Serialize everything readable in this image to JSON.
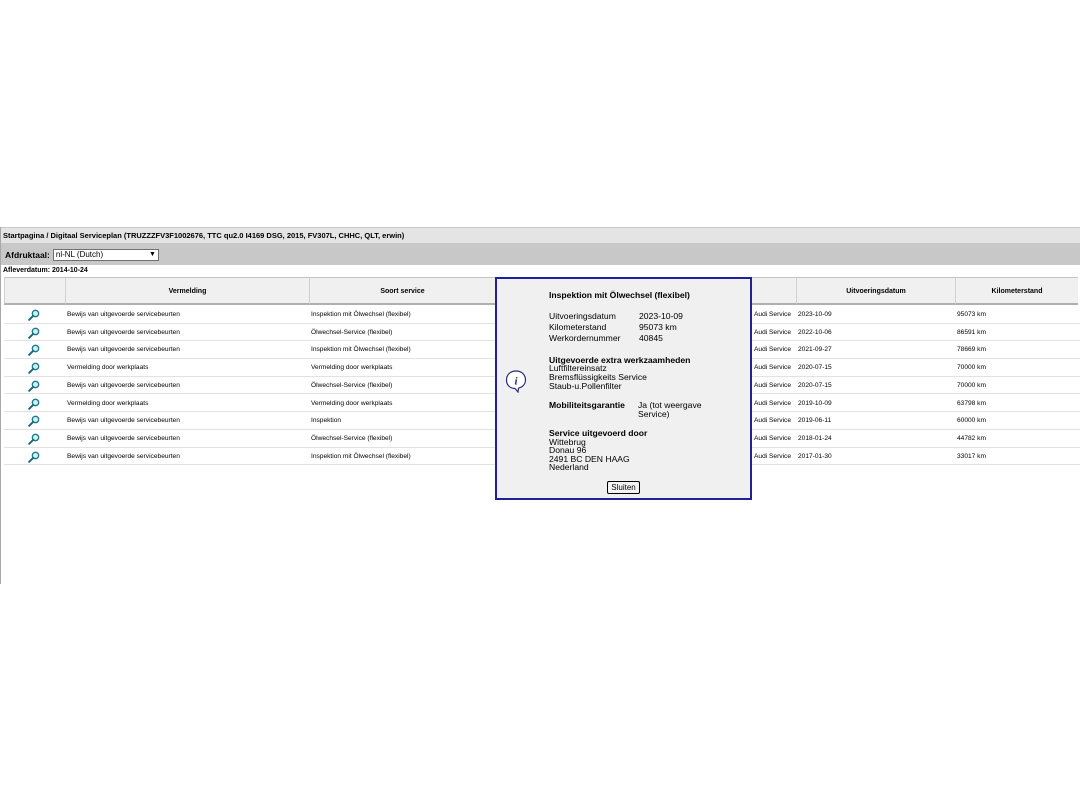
{
  "breadcrumb": "Startpagina / Digitaal Serviceplan (TRUZZZFV3F1002676, TTC qu2.0 I4169 DSG, 2015, FV307L, CHHC, QLT, erwin)",
  "toolbar": {
    "label": "Afdruktaal:",
    "language_value": "nl-NL (Dutch)"
  },
  "delivery_date_text": "Afleverdatum: 2014-10-24",
  "table": {
    "headers": {
      "vermelding": "Vermelding",
      "soort_service": "Soort service",
      "uitvoeringsdatum": "Uitvoeringsdatum",
      "kilometerstand": "Kilometerstand"
    },
    "rows": [
      {
        "vermelding": "Bewijs van uitgevoerde servicebeurten",
        "soort": "Inspektion mit Ölwechsel (flexibel)",
        "dealer": "Audi Service",
        "datum": "2023-10-09",
        "km": "95073 km"
      },
      {
        "vermelding": "Bewijs van uitgevoerde servicebeurten",
        "soort": "Ölwechsel-Service (flexibel)",
        "dealer": "Audi Service",
        "datum": "2022-10-06",
        "km": "86591 km"
      },
      {
        "vermelding": "Bewijs van uitgevoerde servicebeurten",
        "soort": "Inspektion mit Ölwechsel (flexibel)",
        "dealer": "Audi Service",
        "datum": "2021-09-27",
        "km": "78669 km"
      },
      {
        "vermelding": "Vermelding door werkplaats",
        "soort": "Vermelding door werkplaats",
        "dealer": "Audi Service",
        "datum": "2020-07-15",
        "km": "70000 km"
      },
      {
        "vermelding": "Bewijs van uitgevoerde servicebeurten",
        "soort": "Ölwechsel-Service (flexibel)",
        "dealer": "Audi Service",
        "datum": "2020-07-15",
        "km": "70000 km"
      },
      {
        "vermelding": "Vermelding door werkplaats",
        "soort": "Vermelding door werkplaats",
        "dealer": "Audi Service",
        "datum": "2019-10-09",
        "km": "63798 km"
      },
      {
        "vermelding": "Bewijs van uitgevoerde servicebeurten",
        "soort": "Inspektion",
        "dealer": "Audi Service",
        "datum": "2019-06-11",
        "km": "60000 km"
      },
      {
        "vermelding": "Bewijs van uitgevoerde servicebeurten",
        "soort": "Ölwechsel-Service (flexibel)",
        "dealer": "Audi Service",
        "datum": "2018-01-24",
        "km": "44782 km"
      },
      {
        "vermelding": "Bewijs van uitgevoerde servicebeurten",
        "soort": "Inspektion mit Ölwechsel (flexibel)",
        "dealer": "Audi Service",
        "datum": "2017-01-30",
        "km": "33017 km"
      }
    ],
    "row_icon": "magnifier-icon"
  },
  "modal": {
    "title": "Inspektion mit Ölwechsel (flexibel)",
    "details": [
      {
        "label": "Uitvoeringsdatum",
        "value": "2023-10-09"
      },
      {
        "label": "Kilometerstand",
        "value": "95073 km"
      },
      {
        "label": "Werkordernummer",
        "value": "40845"
      }
    ],
    "extra_title": "Uitgevoerde extra werkzaamheden",
    "extra_items": [
      "Luftfiltereinsatz",
      "Bremsflüssigkeits Service",
      "Staub-u.Pollenfilter"
    ],
    "mobility_label": "Mobiliteitsgarantie",
    "mobility_value_line1": "Ja (tot weergave",
    "mobility_value_line2": "Service)",
    "performed_by_title": "Service uitgevoerd door",
    "performed_by_lines": [
      "Wittebrug",
      "Donau 96",
      "2491 BC DEN HAAG",
      "Nederland"
    ],
    "close_label": "Sluiten",
    "icon": "info-icon"
  },
  "colors": {
    "modal_border": "#20209a",
    "toolbar_bg": "#c8c8c8",
    "header_bg": "#f0f0f0",
    "icon_teal": "#1a7a8a"
  }
}
